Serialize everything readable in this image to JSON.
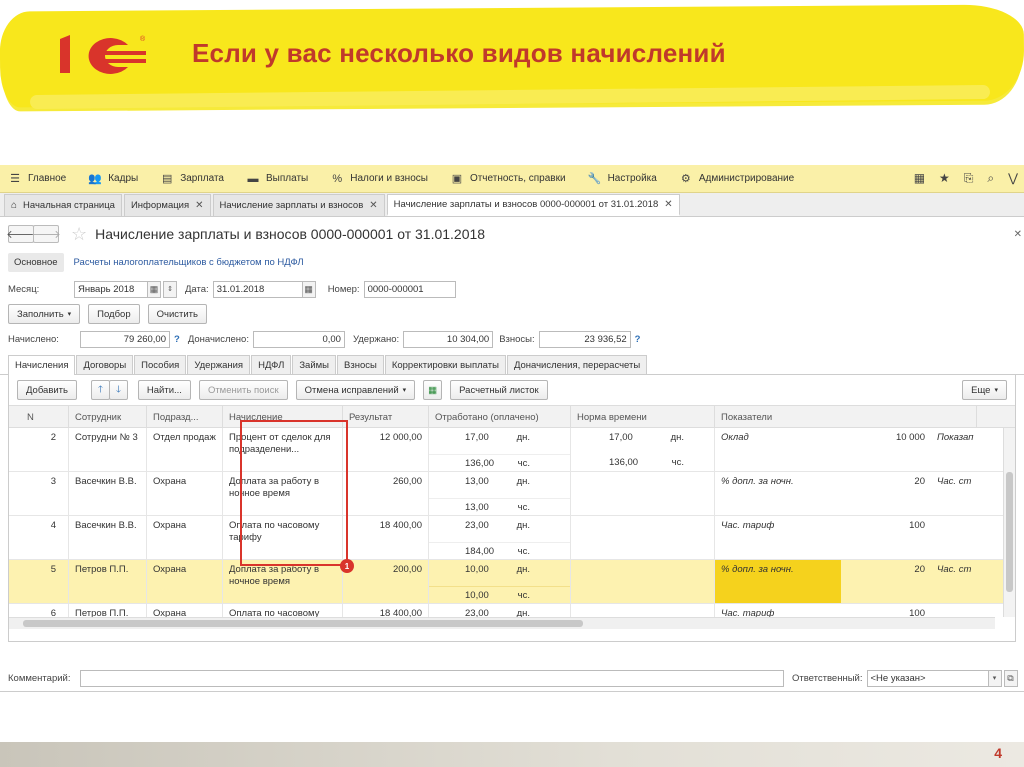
{
  "slide": {
    "title": "Если у вас несколько видов начислений",
    "page_number": "4",
    "logo_text": "1С"
  },
  "menubar": {
    "items": [
      {
        "icon": "hamburger-icon",
        "glyph": "☰",
        "label": "Главное"
      },
      {
        "icon": "people-icon",
        "glyph": "👥",
        "label": "Кадры"
      },
      {
        "icon": "calculator-icon",
        "glyph": "▤",
        "label": "Зарплата"
      },
      {
        "icon": "wallet-icon",
        "glyph": "▬",
        "label": "Выплаты"
      },
      {
        "icon": "percent-icon",
        "glyph": "%",
        "label": "Налоги и взносы"
      },
      {
        "icon": "report-icon",
        "glyph": "▣",
        "label": "Отчетность, справки"
      },
      {
        "icon": "wrench-icon",
        "glyph": "🔧",
        "label": "Настройка"
      },
      {
        "icon": "gear-icon",
        "glyph": "⚙",
        "label": "Администрирование"
      }
    ]
  },
  "tabs": {
    "home": "Начальная страница",
    "info": "Информация",
    "list": "Начисление зарплаты и взносов",
    "doc": "Начисление зарплаты и взносов 0000-000001 от 31.01.2018"
  },
  "doc": {
    "title": "Начисление зарплаты и взносов 0000-000001 от 31.01.2018",
    "subtab_main": "Основное",
    "subtab_link": "Расчеты налогоплательщиков с бюджетом по НДФЛ",
    "month_label": "Месяц:",
    "month_value": "Январь 2018",
    "date_label": "Дата:",
    "date_value": "31.01.2018",
    "number_label": "Номер:",
    "number_value": "0000-000001",
    "fill_btn": "Заполнить",
    "select_btn": "Подбор",
    "clear_btn": "Очистить",
    "accrued_label": "Начислено:",
    "accrued_value": "79 260,00",
    "extra_label": "Доначислено:",
    "extra_value": "0,00",
    "withheld_label": "Удержано:",
    "withheld_value": "10 304,00",
    "contrib_label": "Взносы:",
    "contrib_value": "23 936,52",
    "q": "?"
  },
  "inner_tabs": [
    "Начисления",
    "Договоры",
    "Пособия",
    "Удержания",
    "НДФЛ",
    "Займы",
    "Взносы",
    "Корректировки выплаты",
    "Доначисления, перерасчеты"
  ],
  "toolbar": {
    "add": "Добавить",
    "find": "Найти...",
    "cancel_search": "Отменить поиск",
    "cancel_fix": "Отмена исправлений",
    "payslip": "Расчетный листок",
    "more": "Еще"
  },
  "table": {
    "headers": [
      "N",
      "Сотрудник",
      "Подразд...",
      "Начисление",
      "Результат",
      "Отработано (оплачено)",
      "Норма времени",
      "Показатели"
    ],
    "rows": [
      {
        "n": "2",
        "emp": "Сотрудни № 3",
        "dept": "Отдел продаж",
        "accr": "Процент от сделок для подразделени...",
        "result": "12 000,00",
        "w1": "17,00",
        "u1": "дн.",
        "w2": "136,00",
        "u2": "чс.",
        "n1": "17,00",
        "nu1": "дн.",
        "n2": "136,00",
        "nu2": "чс.",
        "ind": "Оклад",
        "indv": "10 000",
        "ind2": "Показап",
        "hl": false
      },
      {
        "n": "3",
        "emp": "Васечкин В.В.",
        "dept": "Охрана",
        "accr": "Доплата за работу в ночное время",
        "result": "260,00",
        "w1": "13,00",
        "u1": "дн.",
        "w2": "13,00",
        "u2": "чс.",
        "n1": "",
        "nu1": "",
        "n2": "",
        "nu2": "",
        "ind": "% допл. за ночн.",
        "indv": "20",
        "ind2": "Час. ст",
        "hl": false
      },
      {
        "n": "4",
        "emp": "Васечкин В.В.",
        "dept": "Охрана",
        "accr": "Оплата по часовому тарифу",
        "result": "18 400,00",
        "w1": "23,00",
        "u1": "дн.",
        "w2": "184,00",
        "u2": "чс.",
        "n1": "",
        "nu1": "",
        "n2": "",
        "nu2": "",
        "ind": "Час. тариф",
        "indv": "100",
        "ind2": "",
        "hl": false
      },
      {
        "n": "5",
        "emp": "Петров П.П.",
        "dept": "Охрана",
        "accr": "Доплата за работу в ночное время",
        "result": "200,00",
        "w1": "10,00",
        "u1": "дн.",
        "w2": "10,00",
        "u2": "чс.",
        "n1": "",
        "nu1": "",
        "n2": "",
        "nu2": "",
        "ind": "% допл. за ночн.",
        "indv": "20",
        "ind2": "Час. ст",
        "hl": true
      },
      {
        "n": "6",
        "emp": "Петров П.П.",
        "dept": "Охрана",
        "accr": "Оплата по часовому тарифу",
        "result": "18 400,00",
        "w1": "23,00",
        "u1": "дн.",
        "w2": "",
        "u2": "",
        "n1": "",
        "nu1": "",
        "n2": "",
        "nu2": "",
        "ind": "Час. тариф",
        "indv": "100",
        "ind2": "",
        "hl": false
      }
    ]
  },
  "badge": "1",
  "footer": {
    "comment_label": "Комментарий:",
    "comment_value": "",
    "resp_label": "Ответственный:",
    "resp_value": "<Не указан>"
  },
  "colors": {
    "accent_red": "#d9342b",
    "title_red": "#c0392b",
    "menubar_yellow": "#faf0a8",
    "brush_yellow": "#f8e71c",
    "row_highlight": "#fdf2b0"
  }
}
